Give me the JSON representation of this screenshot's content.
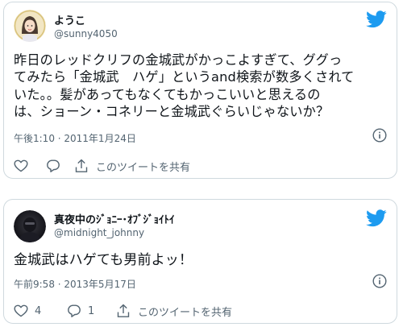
{
  "colors": {
    "twitter_blue": "#1d9bf0",
    "text_primary": "#0f1419",
    "text_secondary": "#536471",
    "border": "#cfd9de"
  },
  "tweets": [
    {
      "display_name": "ようこ",
      "handle": "@sunny4050",
      "text": "昨日のレッドクリフの金城武がかっこよすぎて、ググっ\nてみたら「金城武　ハゲ」というand検索が数多くされて\nいた。。髪があってもなくてもかっこいいと思えるの\nは、ショーン・コネリーと金城武ぐらいじゃないか？",
      "timestamp": "午後1:10 · 2011年1月24日",
      "likes": "",
      "replies": "",
      "share_label": "このツイートを共有",
      "icons": {
        "avatar": "illustrated-avatar",
        "brand": "twitter-bird-icon",
        "info": "info-icon",
        "like": "heart-icon",
        "reply": "reply-bubble-icon",
        "share": "share-icon"
      }
    },
    {
      "display_name": "真夜中のｼﾞｮﾆｰ･ｵﾌﾞｼﾞｮｲﾄｲ",
      "handle": "@midnight_johnny",
      "text": "金城武はハゲても男前よッ！",
      "timestamp": "午前9:58 · 2013年5月17日",
      "likes": "4",
      "replies": "1",
      "share_label": "このツイートを共有",
      "icons": {
        "avatar": "dark-photo-avatar",
        "brand": "twitter-bird-icon",
        "info": "info-icon",
        "like": "heart-icon",
        "reply": "reply-bubble-icon",
        "share": "share-icon"
      }
    }
  ]
}
